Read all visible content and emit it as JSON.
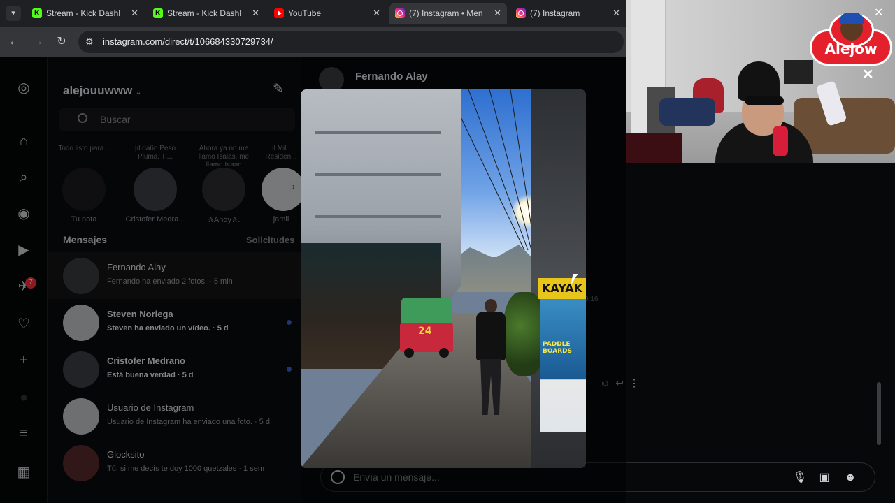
{
  "browser": {
    "tabs": [
      {
        "label": "Stream - Kick Dashbo",
        "icon": "kick",
        "active": false
      },
      {
        "label": "Stream - Kick Dashbo",
        "icon": "kick",
        "active": false
      },
      {
        "label": "YouTube",
        "icon": "youtube",
        "active": false
      },
      {
        "label": "(7) Instagram • Mens",
        "icon": "instagram",
        "active": true
      },
      {
        "label": "(7) Instagram",
        "icon": "instagram",
        "active": false
      }
    ],
    "url": "instagram.com/direct/t/106684330729734/"
  },
  "rail": {
    "badge": "7"
  },
  "inbox": {
    "username": "alejouuwww",
    "search_placeholder": "Buscar",
    "notes": [
      {
        "bubble": "Todo listo para...",
        "name": "Tu nota"
      },
      {
        "bubble": "|ıl daño  Peso Pluma, Ti...",
        "name": "Cristofer Medra..."
      },
      {
        "bubble": "Ahora ya no me llamo Isaias, me llamo Isaac",
        "name": "✰Andy✰."
      },
      {
        "bubble": "|ıl Mil... Residen...",
        "name": "jamil"
      }
    ],
    "messages_title": "Mensajes",
    "requests_label": "Solicitudes",
    "threads": [
      {
        "name": "Fernando Alay",
        "preview": "Fernando ha enviado 2 fotos. · 5 min",
        "bold": false,
        "unread": false,
        "selected": true
      },
      {
        "name": "Steven Noriega",
        "preview": "Steven ha enviado un vídeo. · 5 d",
        "bold": true,
        "unread": true,
        "selected": false
      },
      {
        "name": "Cristofer Medrano",
        "preview": "Está buena verdad · 5 d",
        "bold": true,
        "unread": true,
        "selected": false
      },
      {
        "name": "Usuario de Instagram",
        "preview": "Usuario de Instagram ha enviado una foto. · 5 d",
        "bold": false,
        "unread": false,
        "selected": false
      },
      {
        "name": "Glocksito",
        "preview": "Tú: si me decís te doy 1000 quetzales · 1 sem",
        "bold": false,
        "unread": false,
        "selected": false
      }
    ]
  },
  "chat": {
    "contact_name": "Fernando Alay",
    "message_time": "0:16",
    "composer_placeholder": "Envía un mensaje...",
    "photo_sign": "KAYAK",
    "photo_poster": "PADDLE BOARDS",
    "tuktuk_number": "24"
  },
  "webcam": {
    "logo_text": "Alejow"
  }
}
